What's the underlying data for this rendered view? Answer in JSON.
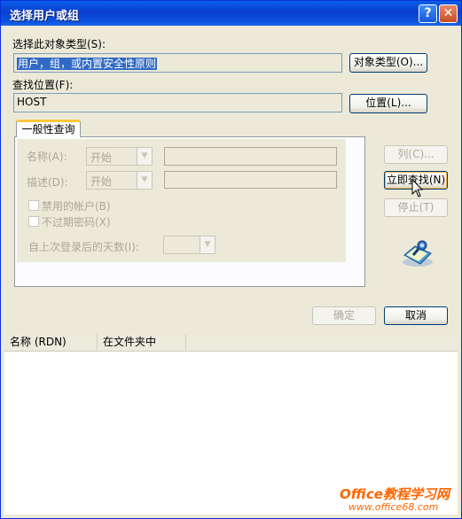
{
  "window": {
    "title": "选择用户或组",
    "help": "?",
    "close": "✕"
  },
  "object_type": {
    "label": "选择此对象类型(S):",
    "value": "用户，组，或内置安全性原则",
    "button": "对象类型(O)..."
  },
  "location": {
    "label": "查找位置(F):",
    "value": "HOST",
    "button": "位置(L)..."
  },
  "tab": {
    "label": "一般性查询",
    "name_label": "名称(A):",
    "name_mode": "开始",
    "desc_label": "描述(D):",
    "desc_mode": "开始",
    "disabled_accounts": "禁用的帐户(B)",
    "non_expiring_pw": "不过期密码(X)",
    "days_since_logon": "自上次登录后的天数(I):"
  },
  "side_buttons": {
    "columns": "列(C)...",
    "find_now": "立即查找(N)",
    "stop": "停止(T)"
  },
  "dialog_buttons": {
    "ok": "确定",
    "cancel": "取消"
  },
  "results": {
    "columns": [
      "名称 (RDN)",
      "在文件夹中"
    ]
  },
  "watermark": {
    "line1": "Office教程学习网",
    "line2": "www.office68.com"
  },
  "colors": {
    "title_bar": "#0a5ee8",
    "selection": "#316ac5",
    "watermark": "#ff6600",
    "tab_accent": "#ffc83c"
  }
}
